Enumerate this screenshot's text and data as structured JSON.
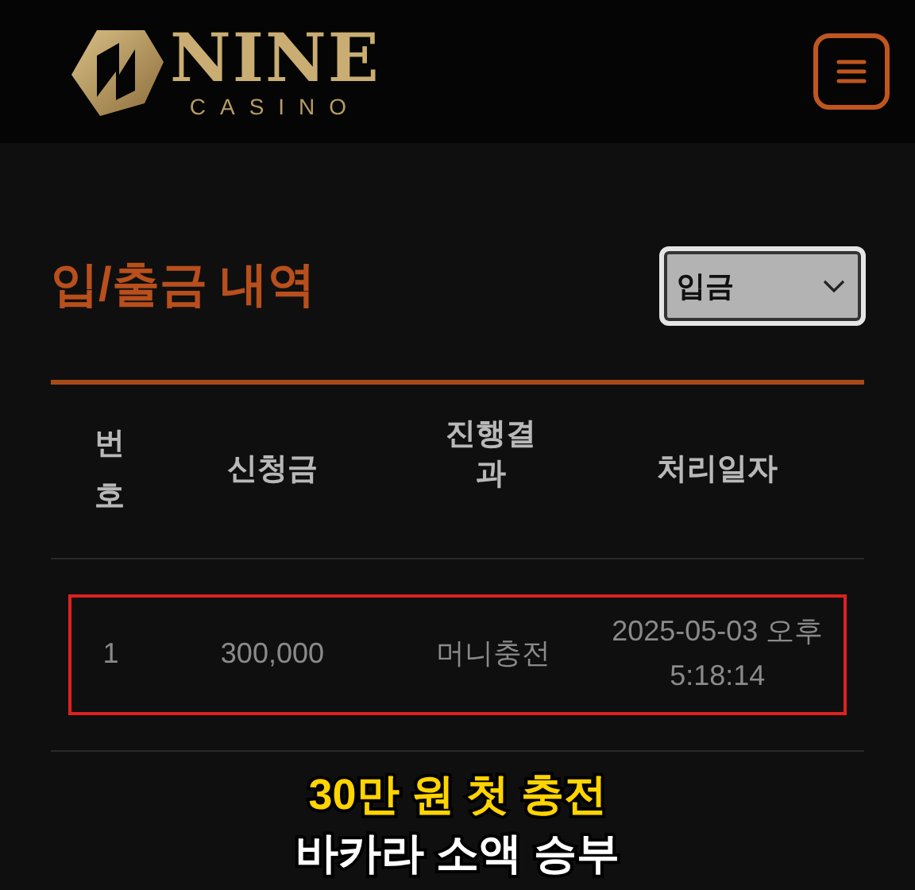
{
  "header": {
    "logo": {
      "name": "NINE",
      "tagline": "CASINO"
    }
  },
  "page_title": "입/출금 내역",
  "filter_select": {
    "value": "입금"
  },
  "table": {
    "columns": [
      "번호",
      "신청금",
      "진행결과",
      "처리일자"
    ],
    "rows": [
      {
        "cells": [
          "1",
          "300,000",
          "머니충전",
          "2025-05-03 오후 5:18:14"
        ],
        "highlighted": true
      }
    ]
  },
  "overlay_caption": {
    "line_1": "30만 원 첫 충전",
    "line_2": "바카라 소액 승부"
  }
}
